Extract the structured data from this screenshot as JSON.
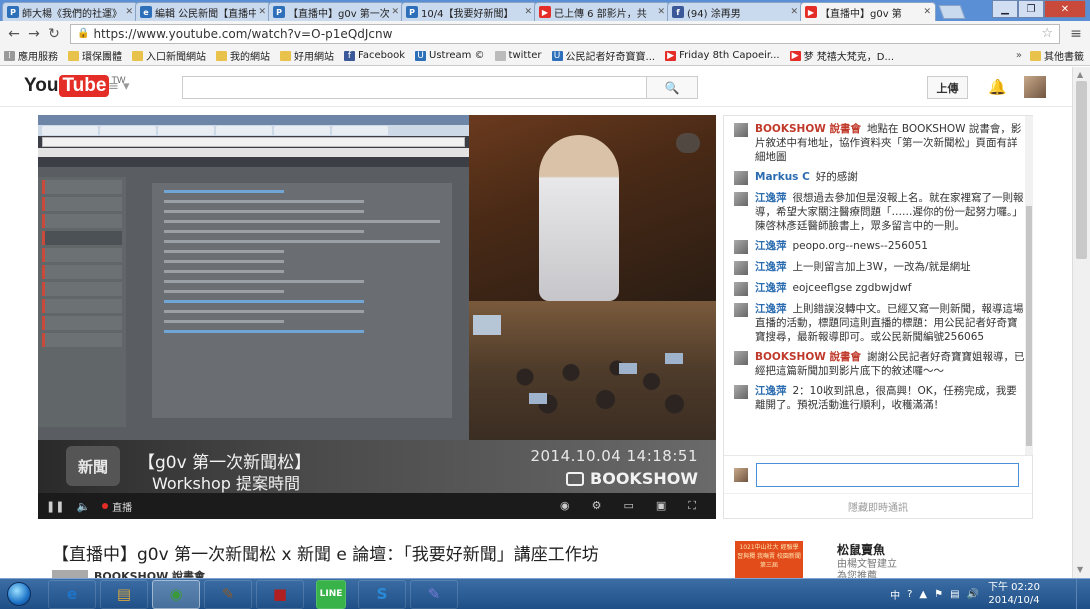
{
  "browser": {
    "tabs": [
      {
        "label": "師大楊《我們的社運》",
        "fav": "P",
        "color": "#2e6fb9"
      },
      {
        "label": "編輯 公民新聞【直播中】",
        "fav": "e",
        "color": "#2e6fb9"
      },
      {
        "label": "【直播中】g0v 第一次新",
        "fav": "P",
        "color": "#2e6fb9"
      },
      {
        "label": "10/4【我要好新聞】",
        "fav": "P",
        "color": "#2e6fb9"
      },
      {
        "label": "已上傳 6 部影片，共",
        "fav": "▶",
        "color": "#e52d27"
      },
      {
        "label": "(94) 涂再男",
        "fav": "f",
        "color": "#3b5998"
      },
      {
        "label": "【直播中】g0v 第",
        "fav": "▶",
        "color": "#e52d27",
        "active": true
      }
    ],
    "url": "https://www.youtube.com/watch?v=O-p1eQdJcnw",
    "bookmarks": [
      {
        "label": "應用服務",
        "type": "apps"
      },
      {
        "label": "環保團體",
        "type": "folder"
      },
      {
        "label": "入口新聞網站",
        "type": "folder"
      },
      {
        "label": "我的網站",
        "type": "folder"
      },
      {
        "label": "好用網站",
        "type": "folder"
      },
      {
        "label": "Facebook",
        "type": "fb"
      },
      {
        "label": "Ustream ©",
        "type": "u"
      },
      {
        "label": "twitter",
        "type": "page"
      },
      {
        "label": "公民記者好奇寶寶...",
        "type": "u"
      },
      {
        "label": "Friday 8th Capoeir...",
        "type": "yt"
      },
      {
        "label": "梦 梵禧大梵克，D...",
        "type": "yt"
      }
    ],
    "bookmarks_more": "其他書籤"
  },
  "youtube": {
    "logo_you": "You",
    "logo_tube": "Tube",
    "logo_region": "TW",
    "upload_label": "上傳",
    "search_placeholder": ""
  },
  "video": {
    "overlay_title_1": "【g0v 第一次新聞松】",
    "overlay_title_2": "Workshop 提案時間",
    "overlay_timestamp": "2014.10.04 14:18:51",
    "overlay_brand": "BOOKSHOW",
    "overlay_badge": "新聞",
    "live_label": "直播",
    "title": "【直播中】g0v 第一次新聞松 x 新聞 e 論壇：「我要好新聞」講座工作坊",
    "channel": "BOOKSHOW 說書會"
  },
  "chat": {
    "messages": [
      {
        "author": "BOOKSHOW 說書會",
        "style": "red",
        "text": "地點在 BOOKSHOW 說書會，影片敘述中有地址，協作資料夾「第一次新聞松」頁面有詳細地圖"
      },
      {
        "author": "Markus C",
        "style": "blue",
        "text": "好的感謝"
      },
      {
        "author": "江逸萍",
        "style": "blue",
        "text": "很想過去參加但是沒報上名。就在家裡寫了一則報導，希望大家關注醫療問題「……遲你的份一起努力囉。」陳啓林彥廷醫師臉書上，眾多留言中的一則。"
      },
      {
        "author": "江逸萍",
        "style": "blue",
        "text": "peopo.org--news--256051"
      },
      {
        "author": "江逸萍",
        "style": "blue",
        "text": "上一則留言加上3W，一改為/就是網址"
      },
      {
        "author": "江逸萍",
        "style": "blue",
        "text": "eojceeflgse zgdbwjdwf"
      },
      {
        "author": "江逸萍",
        "style": "blue",
        "text": "上則錯誤沒轉中文。已經又寫一則新聞，報導這場直播的活動，標題同這則直播的標題：用公民記者好奇寶寶搜尋，最新報導即可。或公民新聞編號256065"
      },
      {
        "author": "BOOKSHOW 說書會",
        "style": "red",
        "text": "謝謝公民記者好奇寶寶姐報導，已經把這篇新聞加到影片底下的敘述囉～～"
      },
      {
        "author": "江逸萍",
        "style": "blue",
        "text": "2：10收到訊息，很高興！OK，任務完成，我要離開了。預祝活動進行順利，收穫滿滿！"
      }
    ],
    "input_value": "",
    "footer": "隱藏即時通訊"
  },
  "suggestion": {
    "thumb_text": "1021中山社大 經驗學習與獨 我嘸賣 校園新聞 第三屆",
    "title": "松鼠賣魚",
    "by": "由楊文智建立",
    "views": "為您推薦"
  },
  "taskbar": {
    "apps": [
      "e",
      "▤",
      "◉",
      "✎",
      "■",
      "LINE",
      "S",
      "✎"
    ],
    "clock_time": "下午 02:20",
    "clock_date": "2014/10/4",
    "lang": "中"
  }
}
